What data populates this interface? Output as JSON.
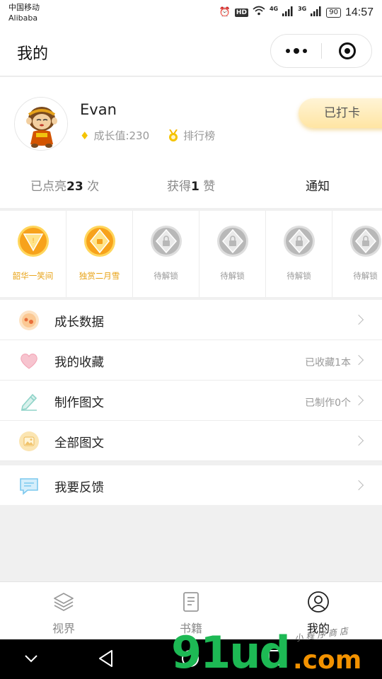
{
  "status_bar": {
    "carrier_line1": "中国移动",
    "carrier_line2": "Alibaba",
    "hd": "HD",
    "net1": "4G",
    "net2": "3G",
    "battery": "90",
    "time": "14:57"
  },
  "header": {
    "title": "我的"
  },
  "profile": {
    "username": "Evan",
    "growth_label": "成长值:",
    "growth_value": "230",
    "ranking_label": "排行榜",
    "checkin_label": "已打卡",
    "stats": {
      "lit_prefix": "已点亮",
      "lit_count": "23",
      "lit_suffix": " 次",
      "likes_prefix": "获得",
      "likes_count": "1",
      "likes_suffix": " 赞",
      "notice": "通知"
    }
  },
  "badges": [
    {
      "label": "韶华一笑间",
      "state": "gold",
      "shape": "triangle",
      "color": "#f7a21b"
    },
    {
      "label": "独赏二月雪",
      "state": "gold",
      "shape": "diamond",
      "color": "#f7a21b"
    },
    {
      "label": "待解锁",
      "state": "locked",
      "color": "#b8b8b8"
    },
    {
      "label": "待解锁",
      "state": "locked",
      "color": "#b8b8b8"
    },
    {
      "label": "待解锁",
      "state": "locked",
      "color": "#b8b8b8"
    },
    {
      "label": "待解锁",
      "state": "locked",
      "color": "#b8b8b8"
    }
  ],
  "menu": [
    {
      "label": "成长数据",
      "value": "",
      "icon": "growth-data-icon"
    },
    {
      "label": "我的收藏",
      "value": "已收藏1本",
      "icon": "heart-icon"
    },
    {
      "label": "制作图文",
      "value": "已制作0个",
      "icon": "pencil-icon"
    },
    {
      "label": "全部图文",
      "value": "",
      "icon": "image-gallery-icon"
    }
  ],
  "feedback": {
    "label": "我要反馈",
    "icon": "chat-icon"
  },
  "tabbar": [
    {
      "label": "视界",
      "icon": "layers-icon",
      "active": false
    },
    {
      "label": "书籍",
      "icon": "book-icon",
      "active": false
    },
    {
      "label": "我的",
      "icon": "user-icon",
      "active": true
    }
  ],
  "watermark": {
    "main": "91ud",
    "suffix": ".com",
    "script": "小程序商店"
  },
  "colors": {
    "gold": "#f7a21b",
    "checkin_bg": "#ffe5a3",
    "gem": "#f5c400",
    "locked": "#b8b8b8",
    "heart": "#f7b7c3",
    "pencil": "#8fd3c8",
    "chat": "#7cc8ee"
  }
}
